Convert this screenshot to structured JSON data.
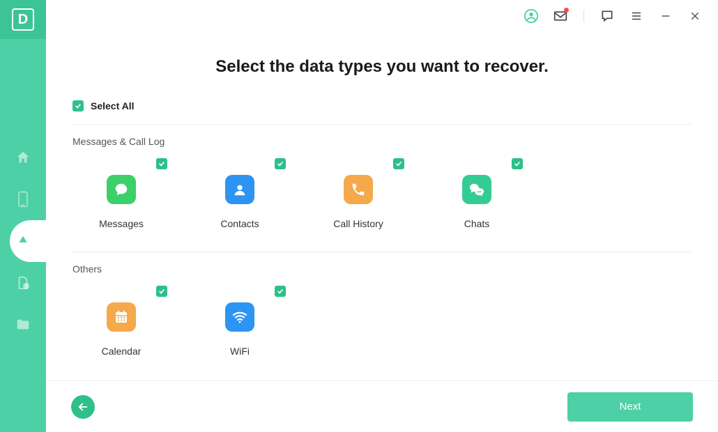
{
  "brand": {
    "letter": "D"
  },
  "sidebar": {
    "items": [
      {
        "name": "home"
      },
      {
        "name": "phone"
      },
      {
        "name": "cloud",
        "active": true
      },
      {
        "name": "file-alert"
      },
      {
        "name": "folder"
      }
    ]
  },
  "titlebar": {
    "icons": [
      "account",
      "mail",
      "feedback",
      "menu",
      "minimize",
      "close"
    ]
  },
  "heading": "Select the data types you want to recover.",
  "select_all_label": "Select All",
  "sections": {
    "messages": {
      "title": "Messages & Call Log",
      "tiles": [
        {
          "label": "Messages",
          "icon": "speech",
          "color": "bg-green",
          "checked": true
        },
        {
          "label": "Contacts",
          "icon": "person",
          "color": "bg-blue",
          "checked": true
        },
        {
          "label": "Call History",
          "icon": "phone",
          "color": "bg-orange",
          "checked": true
        },
        {
          "label": "Chats",
          "icon": "chatdots",
          "color": "bg-teal",
          "checked": true
        }
      ]
    },
    "others": {
      "title": "Others",
      "tiles": [
        {
          "label": "Calendar",
          "icon": "calendar",
          "color": "bg-orange",
          "checked": true
        },
        {
          "label": "WiFi",
          "icon": "wifi",
          "color": "bg-blue",
          "checked": true
        }
      ]
    }
  },
  "footer": {
    "next_label": "Next"
  }
}
